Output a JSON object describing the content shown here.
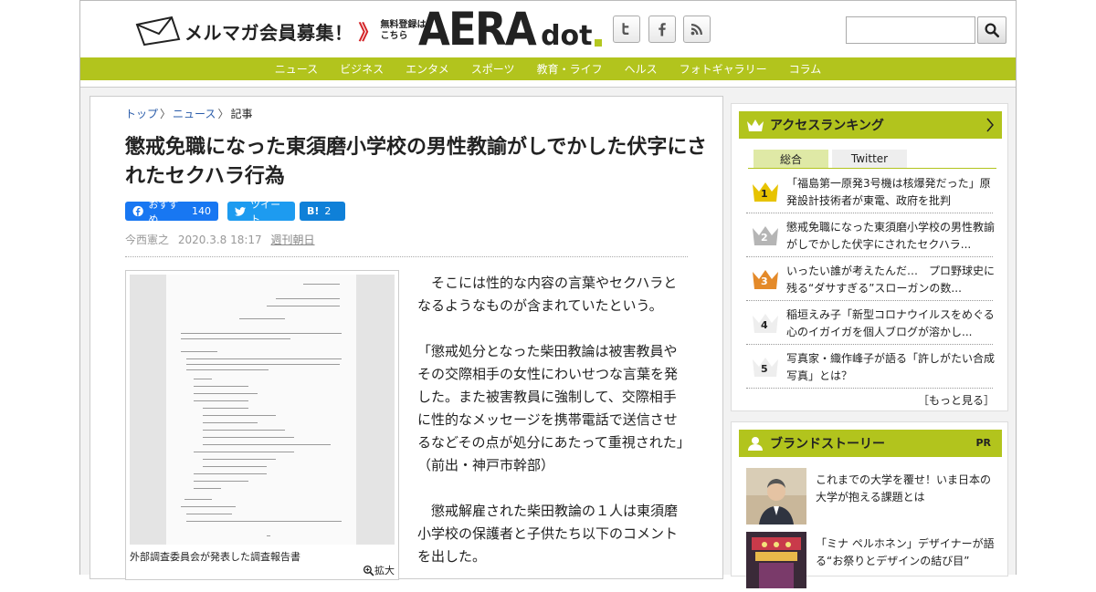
{
  "header": {
    "mailmag_label": "メルマガ会員募集！",
    "mailmag_arrows": "》",
    "free_line1": "無料登録は",
    "free_line2": "こちら",
    "logo_main": "AERA",
    "logo_sub": "dot",
    "search_placeholder": ""
  },
  "nav": [
    "ニュース",
    "ビジネス",
    "エンタメ",
    "スポーツ",
    "教育・ライフ",
    "ヘルス",
    "フォトギャラリー",
    "コラム"
  ],
  "breadcrumb": {
    "home": "トップ",
    "sep": "〉",
    "news": "ニュース",
    "current": "記事"
  },
  "article": {
    "title": "懲戒免職になった東須磨小学校の男性教諭がしでかした伏字にされたセクハラ行為",
    "share": {
      "fb_label": "おすすめ",
      "fb_count": "140",
      "tw_label": "ツイート",
      "hb_label": "B!",
      "hb_count": "2"
    },
    "author": "今西憲之",
    "date": "2020.3.8 18:17",
    "publication": "週刊朝日",
    "figure_caption": "外部調査委員会が発表した調査報告書",
    "enlarge": "拡大",
    "paragraphs": [
      "　そこには性的な内容の言葉やセクハラとなるようなものが含まれていたという。",
      "「懲戒処分となった柴田教論は被害教員やその交際相手の女性にわいせつな言葉を発した。また被害教員に強制して、交際相手に性的なメッセージを携帯電話で送信させるなどその点が処分にあたって重視された」（前出・神戸市幹部）",
      "　懲戒解雇された柴田教論の１人は東須磨小学校の保護者と子供たち以下のコメントを出した。"
    ]
  },
  "ranking": {
    "heading": "アクセスランキング",
    "tab_all": "総合",
    "tab_twitter": "Twitter",
    "items": [
      {
        "rank": "1",
        "text": "「福島第一原発3号機は核爆発だった」原発設計技術者が東電、政府を批判"
      },
      {
        "rank": "2",
        "text": "懲戒免職になった東須磨小学校の男性教諭がしでかした伏字にされたセクハラ..."
      },
      {
        "rank": "3",
        "text": "いったい誰が考えたんだ…　プロ野球史に残る“ダサすぎる”スローガンの数..."
      },
      {
        "rank": "4",
        "text": "稲垣えみ子「新型コロナウイルスをめぐる心のイガイガを個人ブログが溶かし..."
      },
      {
        "rank": "5",
        "text": "写真家・織作峰子が語る「許しがたい合成写真」とは？"
      }
    ],
    "more": "［もっと見る］"
  },
  "brand": {
    "heading": "ブランドストーリー",
    "pr": "PR",
    "items": [
      {
        "text": "これまでの大学を覆せ！いま日本の大学が抱える課題とは"
      },
      {
        "text": "「ミナ ペルホネン」デザイナーが語る“お祭りとデザインの結び目”"
      }
    ]
  },
  "colors": {
    "accent": "#b2c41d",
    "gold": "#e7c300",
    "silver": "#b5b5b5",
    "bronze": "#e48a2a",
    "fb": "#1877f2",
    "twitter": "#1d9bf0"
  }
}
